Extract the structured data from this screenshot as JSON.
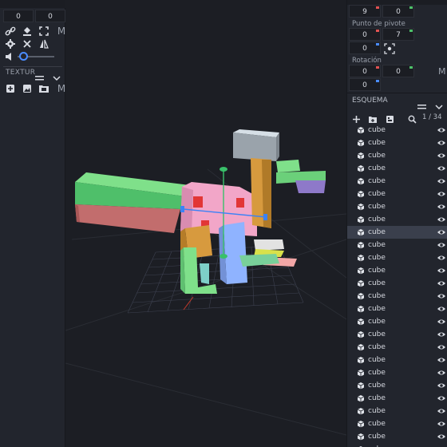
{
  "left_panel": {
    "top_values": [
      "0",
      "0"
    ],
    "texture_label": "TEXTUR",
    "trailing_letter": "M"
  },
  "right_panel": {
    "size_values": [
      "9",
      "0"
    ],
    "pivot_label": "Punto de pivote",
    "pivot_values": [
      "0",
      "7",
      "0"
    ],
    "rotation_label": "Rotación",
    "rotation_values": [
      "0",
      "0",
      "0"
    ],
    "trailing_letter": "M",
    "outliner_title": "ESQUEMA",
    "outliner_counter": "1 / 34",
    "items": [
      {
        "name": "cube",
        "selected": false
      },
      {
        "name": "cube",
        "selected": false
      },
      {
        "name": "cube",
        "selected": false
      },
      {
        "name": "cube",
        "selected": false
      },
      {
        "name": "cube",
        "selected": false
      },
      {
        "name": "cube",
        "selected": false
      },
      {
        "name": "cube",
        "selected": false
      },
      {
        "name": "cube",
        "selected": false
      },
      {
        "name": "cube",
        "selected": true
      },
      {
        "name": "cube",
        "selected": false
      },
      {
        "name": "cube",
        "selected": false
      },
      {
        "name": "cube",
        "selected": false
      },
      {
        "name": "cube",
        "selected": false
      },
      {
        "name": "cube",
        "selected": false
      },
      {
        "name": "cube",
        "selected": false
      },
      {
        "name": "cube",
        "selected": false
      },
      {
        "name": "cube",
        "selected": false
      },
      {
        "name": "cube",
        "selected": false
      },
      {
        "name": "cube",
        "selected": false
      },
      {
        "name": "cube",
        "selected": false
      },
      {
        "name": "cube",
        "selected": false
      },
      {
        "name": "cube",
        "selected": false
      },
      {
        "name": "cube",
        "selected": false
      },
      {
        "name": "cube",
        "selected": false
      },
      {
        "name": "cube",
        "selected": false
      },
      {
        "name": "cube",
        "selected": false
      }
    ]
  },
  "colors": {
    "panel_bg": "#22252d",
    "viewport_bg": "#1c1e24",
    "selected_row": "#3a3f4c",
    "accent_blue": "#3b82f6"
  },
  "icons": [
    "link-icon",
    "paint-bucket-icon",
    "resize-icon",
    "gear-icon",
    "x-icon",
    "mirror-icon",
    "volume-icon",
    "slider-knob-icon",
    "menu-lines-icon",
    "chevron-down-icon",
    "add-texture-icon",
    "image-icon",
    "folder-image-icon",
    "plus-icon",
    "add-folder-icon",
    "add-group-icon",
    "search-icon",
    "cube-icon",
    "eye-icon",
    "lock-icon"
  ]
}
